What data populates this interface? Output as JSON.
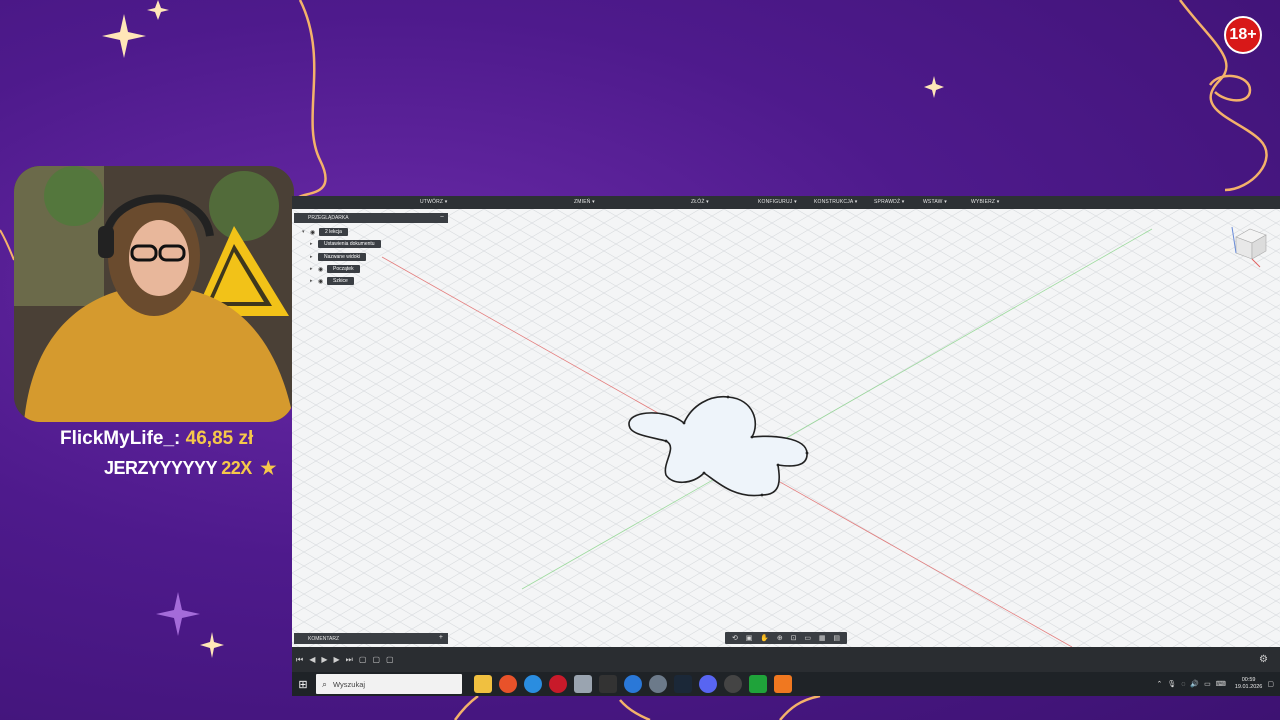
{
  "overlay": {
    "age_badge": "18+",
    "donation": {
      "name": "FlickMyLife_:",
      "amount": "46,85 zł"
    },
    "sub_alert": {
      "name": "JERZYYYYYY",
      "count": "22X"
    }
  },
  "cad": {
    "toolbar": [
      {
        "label": "UTWÓRZ ▾"
      },
      {
        "label": "ZMIEŃ ▾"
      },
      {
        "label": "ZŁÓŻ ▾"
      },
      {
        "label": "KONFIGURUJ ▾"
      },
      {
        "label": "KONSTRUKCJA ▾"
      },
      {
        "label": "SPRAWDŹ ▾"
      },
      {
        "label": "WSTAW ▾"
      },
      {
        "label": "WYBIERZ ▾"
      }
    ],
    "browser": {
      "title": "PRZEGLĄDARKA",
      "root": "2 lekcja",
      "items": [
        {
          "label": "Ustawienia dokumentu"
        },
        {
          "label": "Nazwane widoki"
        },
        {
          "label": "Początek"
        },
        {
          "label": "Szkice"
        }
      ]
    },
    "comments_label": "KOMENTARZ",
    "colors": {
      "viewport_bg": "#f4f5f6",
      "panel_bg": "#3a3e43",
      "toolbar_bg": "#2d3135",
      "x_axis": "#e06060",
      "y_axis": "#7ad07a"
    }
  },
  "taskbar": {
    "search_placeholder": "Wyszukaj",
    "time": "00:59",
    "date": "19.01.2026"
  }
}
